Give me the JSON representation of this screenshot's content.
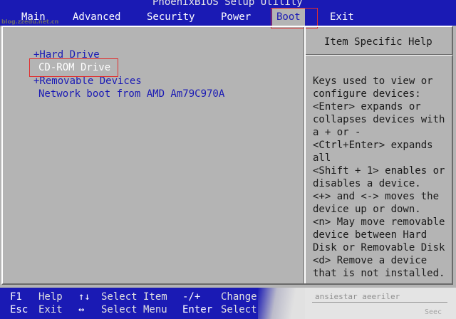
{
  "window": {
    "title": "PhoenixBIOS Setup Utility",
    "watermark": "blog.zzedu.net.cn"
  },
  "menu": {
    "items": [
      "Main",
      "Advanced",
      "Security",
      "Power",
      "Boot",
      "Exit"
    ],
    "selected": "Boot"
  },
  "boot": {
    "items": [
      {
        "label": "+Hard Drive"
      },
      {
        "label": "CD-ROM Drive"
      },
      {
        "label": "+Removable Devices"
      },
      {
        "label": "Network boot from AMD Am79C970A"
      }
    ],
    "selected": "CD-ROM Drive"
  },
  "help": {
    "title": "Item Specific Help",
    "lines": [
      "Keys used to view or",
      "configure devices:",
      "<Enter> expands or",
      "collapses devices with",
      "a + or -",
      "<Ctrl+Enter> expands",
      "all",
      "<Shift + 1> enables or",
      "disables a device.",
      "<+> and <-> moves the",
      "device up or down.",
      "<n> May move removable",
      "device between Hard",
      "Disk or Removable Disk",
      "<d> Remove a device",
      "that is not installed."
    ]
  },
  "status": {
    "row1": [
      {
        "key": "F1",
        "desc": "Help"
      },
      {
        "key": "↑↓",
        "desc": "Select Item"
      },
      {
        "key": "-/+",
        "desc": "Change"
      }
    ],
    "row2": [
      {
        "key": "Esc",
        "desc": "Exit"
      },
      {
        "key": "↔",
        "desc": "Select Menu"
      },
      {
        "key": "Enter",
        "desc": "Select"
      }
    ],
    "right_blur1": "ansiestar aeeriler",
    "right_blur2": "Seec"
  },
  "colors": {
    "bios_blue": "#1a1ab4",
    "bios_gray": "#b4b4b4",
    "highlight_red": "#e03030"
  }
}
